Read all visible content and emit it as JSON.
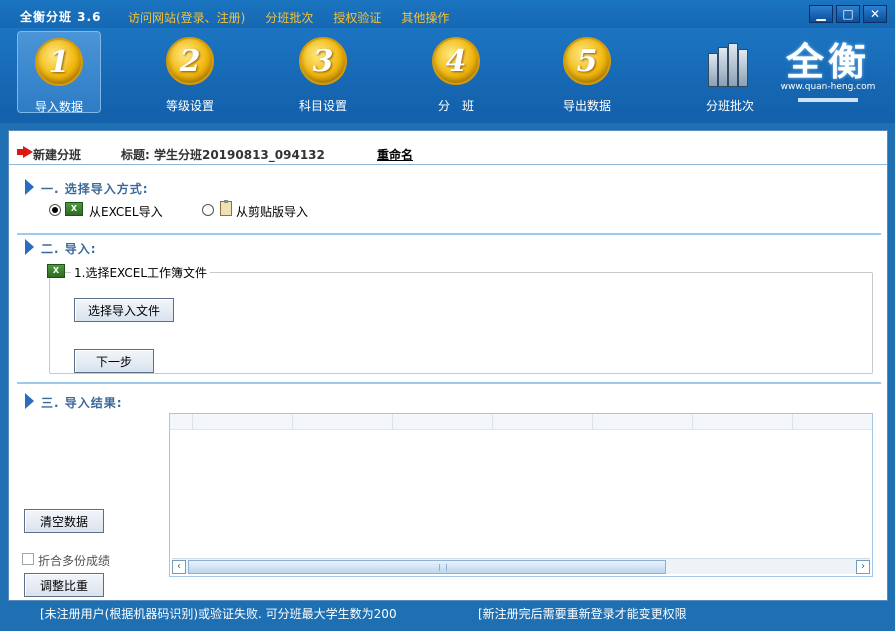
{
  "app": {
    "title": "全衡分班 3.6",
    "menu": [
      "访问网站(登录、注册)",
      "分班批次",
      "授权验证",
      "其他操作"
    ],
    "window_buttons": {
      "minimize": "▁",
      "maximize": "□",
      "close": "✕"
    }
  },
  "toolbar": {
    "steps": [
      {
        "number": "1",
        "label": "导入数据",
        "active": true
      },
      {
        "number": "2",
        "label": "等级设置",
        "active": false
      },
      {
        "number": "3",
        "label": "科目设置",
        "active": false
      },
      {
        "number": "4",
        "label": "分　班",
        "active": false
      },
      {
        "number": "5",
        "label": "导出数据",
        "active": false
      }
    ],
    "batch_label": "分班批次",
    "logo_text": "全衡",
    "logo_url": "www.quan-heng.com"
  },
  "header": {
    "new_label": "新建分班",
    "title_label": "标题: 学生分班20190813_094132",
    "rename_label": "重命名"
  },
  "section1": {
    "title": "一. 选择导入方式:",
    "option_excel": "从EXCEL导入",
    "option_clipboard": "从剪贴版导入",
    "selected": "excel"
  },
  "section2": {
    "title": "二. 导入:",
    "group_title": "1.选择EXCEL工作簿文件",
    "select_file_button": "选择导入文件",
    "next_button": "下一步"
  },
  "section3": {
    "title": "三. 导入结果:",
    "clear_button": "清空数据",
    "merge_checkbox_label": "折合多份成绩",
    "merge_checked": false,
    "adjust_button": "调整比重"
  },
  "statusbar": {
    "left": "[未注册用户(根据机器码识别)或验证失败. 可分班最大学生数为200",
    "right": "[新注册完后需要重新登录才能变更权限"
  },
  "colors": {
    "frame_blue": "#1f6fb3",
    "menu_gold": "#f3c23a",
    "badge_gold": "#f1b70c",
    "section_blue": "#3b6a9a"
  }
}
